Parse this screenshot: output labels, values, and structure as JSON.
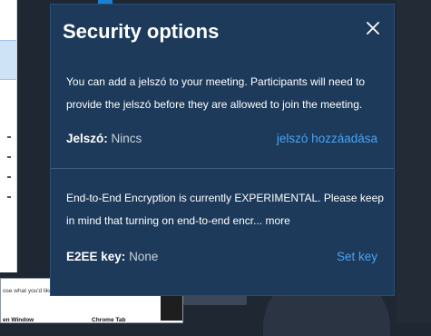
{
  "background": {
    "share_prompt": "ose what you'd like to share.",
    "share_option_window": "en Window",
    "share_option_tab": "Chrome Tab"
  },
  "dialog": {
    "title": "Security options",
    "close_icon": "close-icon",
    "passcode_section": {
      "description": "You can add a jelszó to your meeting. Participants will need to provide the jelszó before they are allowed to join the meeting.",
      "label": "Jelszó:",
      "value": "Nincs",
      "action": "jelszó hozzáadása"
    },
    "e2ee_section": {
      "description": "End-to-End Encryption is currently EXPERIMENTAL. Please keep in mind that turning on end-to-end encr... more",
      "label": "E2EE key:",
      "value": "None",
      "action": "Set key"
    }
  },
  "colors": {
    "dialog_bg": "#1d3a5a",
    "link": "#4aa3f2",
    "text": "#ffffff"
  }
}
